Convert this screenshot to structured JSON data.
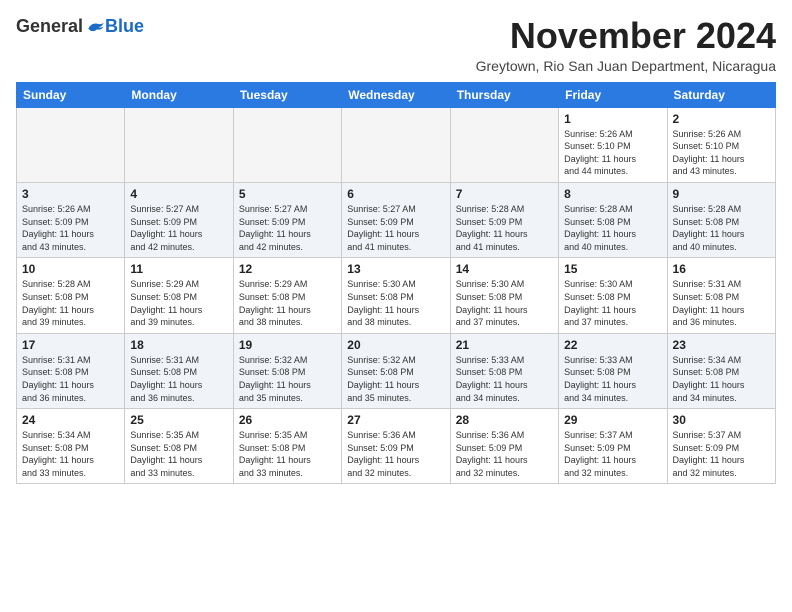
{
  "header": {
    "logo": {
      "general": "General",
      "blue": "Blue"
    },
    "title": "November 2024",
    "subtitle": "Greytown, Rio San Juan Department, Nicaragua"
  },
  "weekdays": [
    "Sunday",
    "Monday",
    "Tuesday",
    "Wednesday",
    "Thursday",
    "Friday",
    "Saturday"
  ],
  "weeks": [
    [
      {
        "day": "",
        "info": ""
      },
      {
        "day": "",
        "info": ""
      },
      {
        "day": "",
        "info": ""
      },
      {
        "day": "",
        "info": ""
      },
      {
        "day": "",
        "info": ""
      },
      {
        "day": "1",
        "info": "Sunrise: 5:26 AM\nSunset: 5:10 PM\nDaylight: 11 hours\nand 44 minutes."
      },
      {
        "day": "2",
        "info": "Sunrise: 5:26 AM\nSunset: 5:10 PM\nDaylight: 11 hours\nand 43 minutes."
      }
    ],
    [
      {
        "day": "3",
        "info": "Sunrise: 5:26 AM\nSunset: 5:09 PM\nDaylight: 11 hours\nand 43 minutes."
      },
      {
        "day": "4",
        "info": "Sunrise: 5:27 AM\nSunset: 5:09 PM\nDaylight: 11 hours\nand 42 minutes."
      },
      {
        "day": "5",
        "info": "Sunrise: 5:27 AM\nSunset: 5:09 PM\nDaylight: 11 hours\nand 42 minutes."
      },
      {
        "day": "6",
        "info": "Sunrise: 5:27 AM\nSunset: 5:09 PM\nDaylight: 11 hours\nand 41 minutes."
      },
      {
        "day": "7",
        "info": "Sunrise: 5:28 AM\nSunset: 5:09 PM\nDaylight: 11 hours\nand 41 minutes."
      },
      {
        "day": "8",
        "info": "Sunrise: 5:28 AM\nSunset: 5:08 PM\nDaylight: 11 hours\nand 40 minutes."
      },
      {
        "day": "9",
        "info": "Sunrise: 5:28 AM\nSunset: 5:08 PM\nDaylight: 11 hours\nand 40 minutes."
      }
    ],
    [
      {
        "day": "10",
        "info": "Sunrise: 5:28 AM\nSunset: 5:08 PM\nDaylight: 11 hours\nand 39 minutes."
      },
      {
        "day": "11",
        "info": "Sunrise: 5:29 AM\nSunset: 5:08 PM\nDaylight: 11 hours\nand 39 minutes."
      },
      {
        "day": "12",
        "info": "Sunrise: 5:29 AM\nSunset: 5:08 PM\nDaylight: 11 hours\nand 38 minutes."
      },
      {
        "day": "13",
        "info": "Sunrise: 5:30 AM\nSunset: 5:08 PM\nDaylight: 11 hours\nand 38 minutes."
      },
      {
        "day": "14",
        "info": "Sunrise: 5:30 AM\nSunset: 5:08 PM\nDaylight: 11 hours\nand 37 minutes."
      },
      {
        "day": "15",
        "info": "Sunrise: 5:30 AM\nSunset: 5:08 PM\nDaylight: 11 hours\nand 37 minutes."
      },
      {
        "day": "16",
        "info": "Sunrise: 5:31 AM\nSunset: 5:08 PM\nDaylight: 11 hours\nand 36 minutes."
      }
    ],
    [
      {
        "day": "17",
        "info": "Sunrise: 5:31 AM\nSunset: 5:08 PM\nDaylight: 11 hours\nand 36 minutes."
      },
      {
        "day": "18",
        "info": "Sunrise: 5:31 AM\nSunset: 5:08 PM\nDaylight: 11 hours\nand 36 minutes."
      },
      {
        "day": "19",
        "info": "Sunrise: 5:32 AM\nSunset: 5:08 PM\nDaylight: 11 hours\nand 35 minutes."
      },
      {
        "day": "20",
        "info": "Sunrise: 5:32 AM\nSunset: 5:08 PM\nDaylight: 11 hours\nand 35 minutes."
      },
      {
        "day": "21",
        "info": "Sunrise: 5:33 AM\nSunset: 5:08 PM\nDaylight: 11 hours\nand 34 minutes."
      },
      {
        "day": "22",
        "info": "Sunrise: 5:33 AM\nSunset: 5:08 PM\nDaylight: 11 hours\nand 34 minutes."
      },
      {
        "day": "23",
        "info": "Sunrise: 5:34 AM\nSunset: 5:08 PM\nDaylight: 11 hours\nand 34 minutes."
      }
    ],
    [
      {
        "day": "24",
        "info": "Sunrise: 5:34 AM\nSunset: 5:08 PM\nDaylight: 11 hours\nand 33 minutes."
      },
      {
        "day": "25",
        "info": "Sunrise: 5:35 AM\nSunset: 5:08 PM\nDaylight: 11 hours\nand 33 minutes."
      },
      {
        "day": "26",
        "info": "Sunrise: 5:35 AM\nSunset: 5:08 PM\nDaylight: 11 hours\nand 33 minutes."
      },
      {
        "day": "27",
        "info": "Sunrise: 5:36 AM\nSunset: 5:09 PM\nDaylight: 11 hours\nand 32 minutes."
      },
      {
        "day": "28",
        "info": "Sunrise: 5:36 AM\nSunset: 5:09 PM\nDaylight: 11 hours\nand 32 minutes."
      },
      {
        "day": "29",
        "info": "Sunrise: 5:37 AM\nSunset: 5:09 PM\nDaylight: 11 hours\nand 32 minutes."
      },
      {
        "day": "30",
        "info": "Sunrise: 5:37 AM\nSunset: 5:09 PM\nDaylight: 11 hours\nand 32 minutes."
      }
    ]
  ]
}
